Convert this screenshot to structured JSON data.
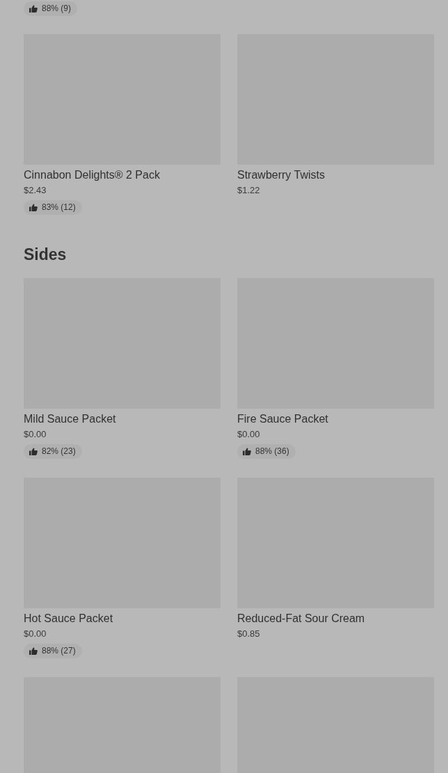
{
  "top_rating": "88% (9)",
  "sections": [
    {
      "items": [
        {
          "kind": "placeholder",
          "name": "Cinnabon Delights® 2 Pack",
          "price": "$2.43",
          "rating": "83% (12)"
        },
        {
          "kind": "placeholder",
          "name": "Strawberry Twists",
          "price": "$1.22"
        }
      ]
    },
    {
      "title": "Sides",
      "items": [
        {
          "kind": "placeholder",
          "name": "Mild Sauce Packet",
          "price": "$0.00",
          "rating": "82% (23)"
        },
        {
          "kind": "placeholder",
          "name": "Fire Sauce Packet",
          "price": "$0.00",
          "rating": "88% (36)"
        },
        {
          "kind": "placeholder",
          "name": "Hot Sauce Packet",
          "price": "$0.00",
          "rating": "88% (27)"
        },
        {
          "kind": "placeholder",
          "name": "Reduced-Fat Sour Cream",
          "price": "$0.85"
        },
        {
          "kind": "placeholder"
        },
        {
          "kind": "placeholder"
        }
      ]
    }
  ]
}
